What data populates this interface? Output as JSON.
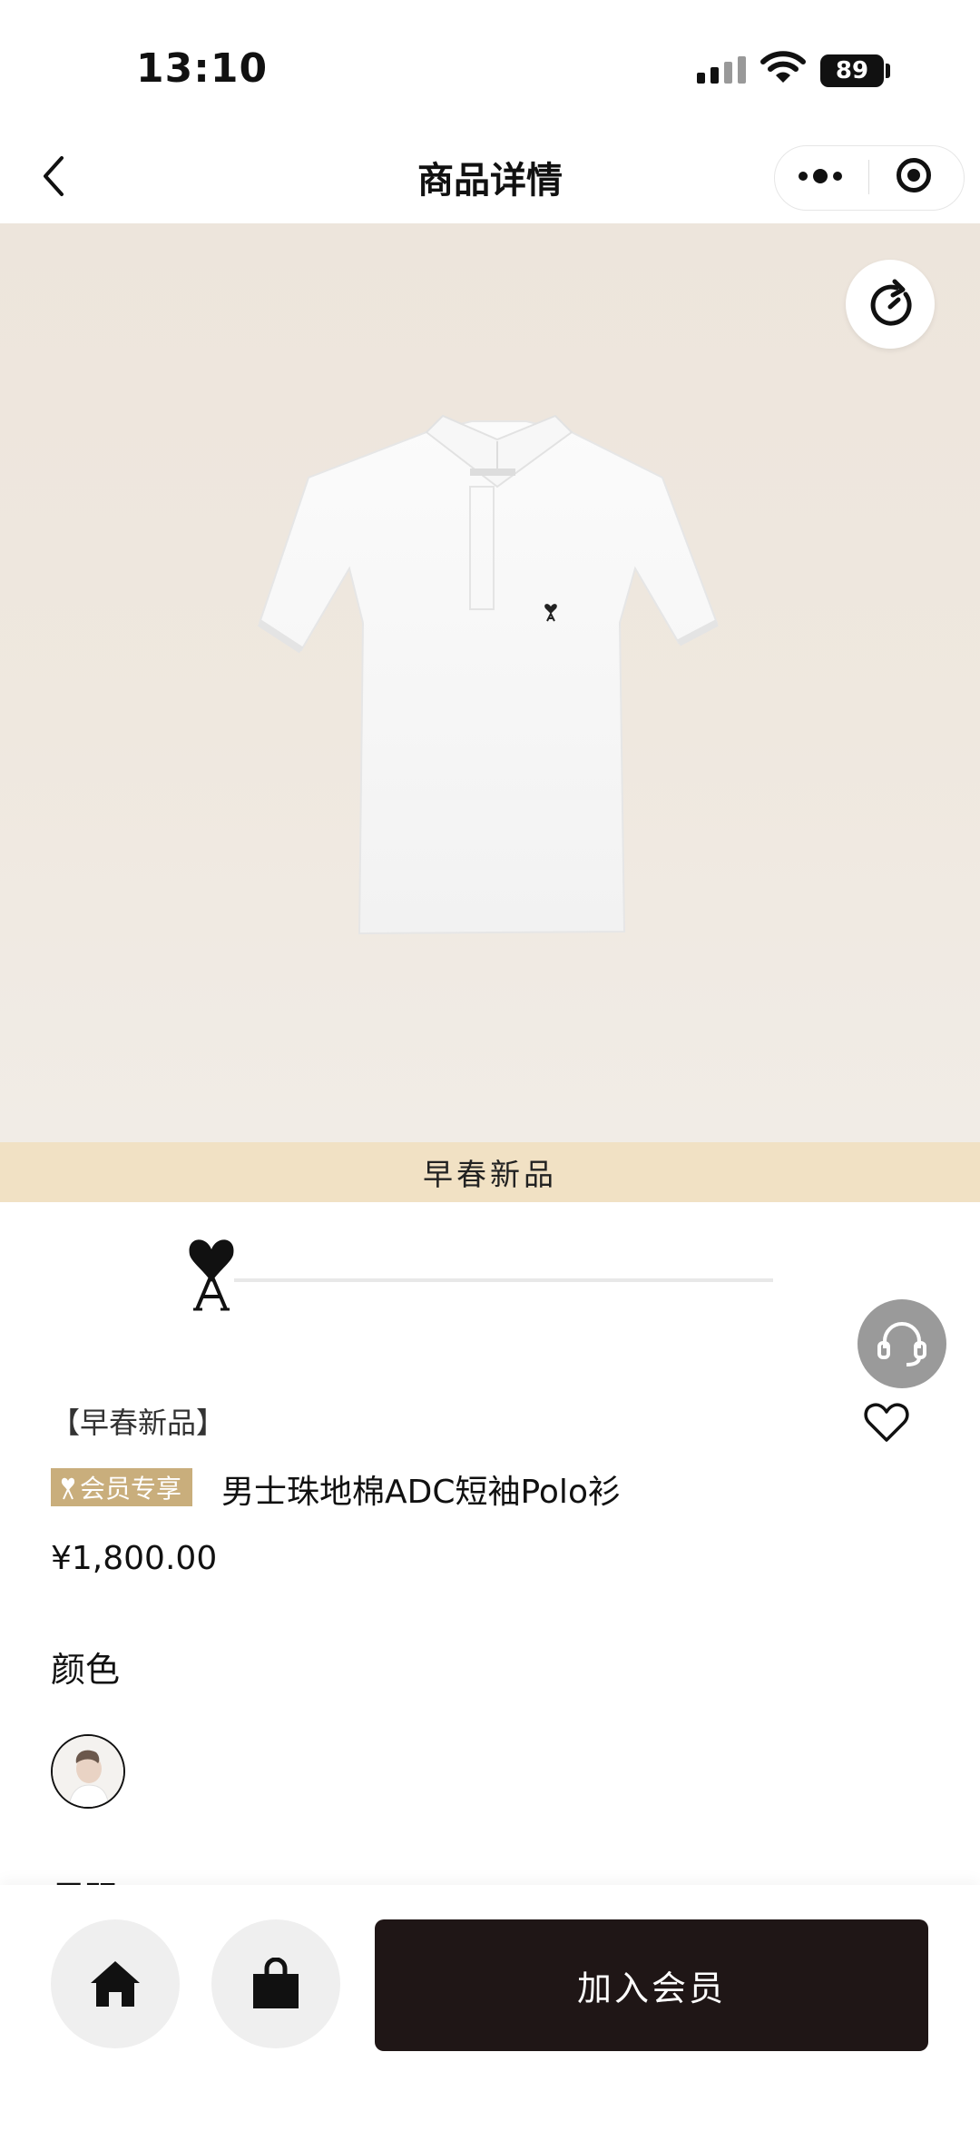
{
  "status_bar": {
    "time": "13:10",
    "battery": "89"
  },
  "nav": {
    "title": "商品详情"
  },
  "hero": {
    "banner_text": "早春新品"
  },
  "product": {
    "sub_tag": "【早春新品】",
    "member_badge": "会员专享",
    "title": "男士珠地棉ADC短袖Polo衫",
    "price": "¥1,800.00"
  },
  "options": {
    "color_label": "颜色",
    "next_label_cut": "尺码"
  },
  "bottom_bar": {
    "join_label": "加入会员"
  },
  "icons": [
    "back-arrow-icon",
    "more-dots-icon",
    "close-target-icon",
    "refresh-icon",
    "customer-service-icon",
    "heart-icon",
    "home-icon",
    "shopping-bag-icon",
    "brand-logo-icon"
  ],
  "colors": {
    "accent_gold": "#c9ae7c",
    "banner_bg": "#f1e1c4",
    "primary_button": "#1f1616"
  }
}
